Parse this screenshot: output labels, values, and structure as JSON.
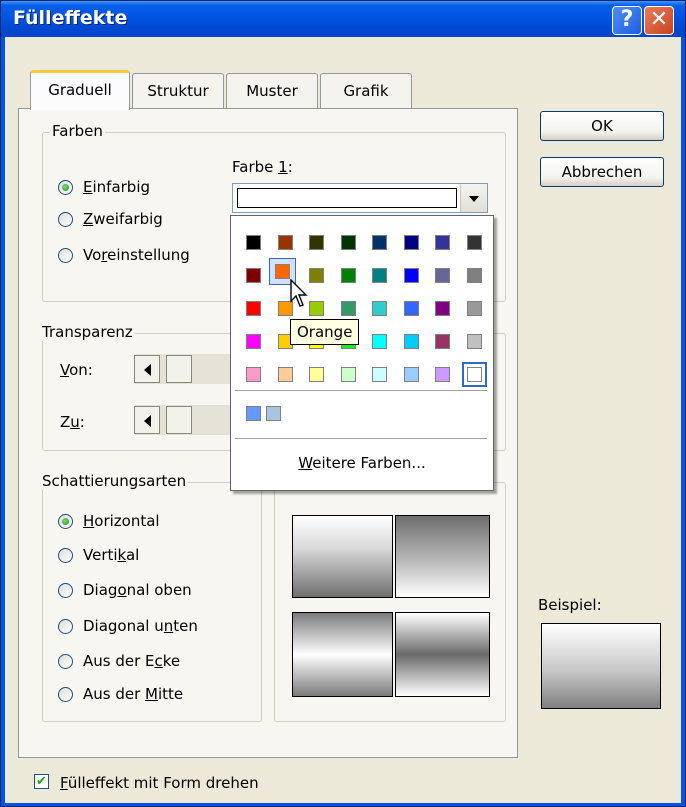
{
  "window": {
    "title": "Fülleffekte"
  },
  "titlebar_buttons": {
    "help": "?",
    "close": "✕"
  },
  "tabs": [
    "Graduell",
    "Struktur",
    "Muster",
    "Grafik"
  ],
  "buttons": {
    "ok": "OK",
    "cancel": "Abbrechen"
  },
  "farben": {
    "legend": "Farben",
    "farbe1_label_pre": "Farbe ",
    "farbe1_label_key": "1",
    "farbe1_label_post": ":",
    "options": [
      {
        "pre": "",
        "key": "E",
        "post": "infarbig",
        "selected": true
      },
      {
        "pre": "",
        "key": "Z",
        "post": "weifarbig",
        "selected": false
      },
      {
        "pre": "Vo",
        "key": "r",
        "post": "einstellung",
        "selected": false
      }
    ]
  },
  "transparenz": {
    "legend": "Transparenz",
    "von": {
      "key": "V",
      "post": "on:"
    },
    "zu": {
      "pre": "Z",
      "key": "u",
      "post": ":"
    }
  },
  "schattierung": {
    "legend": "Schattierungsarten",
    "options": [
      {
        "pre": "",
        "key": "H",
        "post": "orizontal",
        "selected": true
      },
      {
        "pre": "Verti",
        "key": "k",
        "post": "al",
        "selected": false
      },
      {
        "pre": "Diag",
        "key": "o",
        "post": "nal oben",
        "selected": false
      },
      {
        "pre": "Diagonal u",
        "key": "n",
        "post": "ten",
        "selected": false
      },
      {
        "pre": "Aus der E",
        "key": "c",
        "post": "ke",
        "selected": false
      },
      {
        "pre": "Aus der ",
        "key": "M",
        "post": "itte",
        "selected": false
      }
    ]
  },
  "beispiel_label": "Beispiel:",
  "checkbox": {
    "key": "F",
    "post": "ülleffekt mit Form drehen",
    "checked": true
  },
  "color_popup": {
    "rows": [
      [
        "#000000",
        "#993300",
        "#333300",
        "#003300",
        "#003366",
        "#000080",
        "#333399",
        "#333333"
      ],
      [
        "#800000",
        "#ff6600",
        "#808000",
        "#008000",
        "#008080",
        "#0000ff",
        "#666699",
        "#808080"
      ],
      [
        "#ff0000",
        "#ff9900",
        "#99cc00",
        "#339966",
        "#33cccc",
        "#3366ff",
        "#800080",
        "#999999"
      ],
      [
        "#ff00ff",
        "#ffcc00",
        "#ffff00",
        "#00ff00",
        "#00ffff",
        "#00ccff",
        "#993366",
        "#c0c0c0"
      ],
      [
        "#ff99cc",
        "#ffcc99",
        "#ffff99",
        "#ccffcc",
        "#ccffff",
        "#99ccff",
        "#cc99ff",
        "#ffffff"
      ]
    ],
    "recent": [
      "#6699ff",
      "#a8c4e0"
    ],
    "more_key": "W",
    "more_post": "eitere Farben..."
  },
  "tooltip": "Orange"
}
